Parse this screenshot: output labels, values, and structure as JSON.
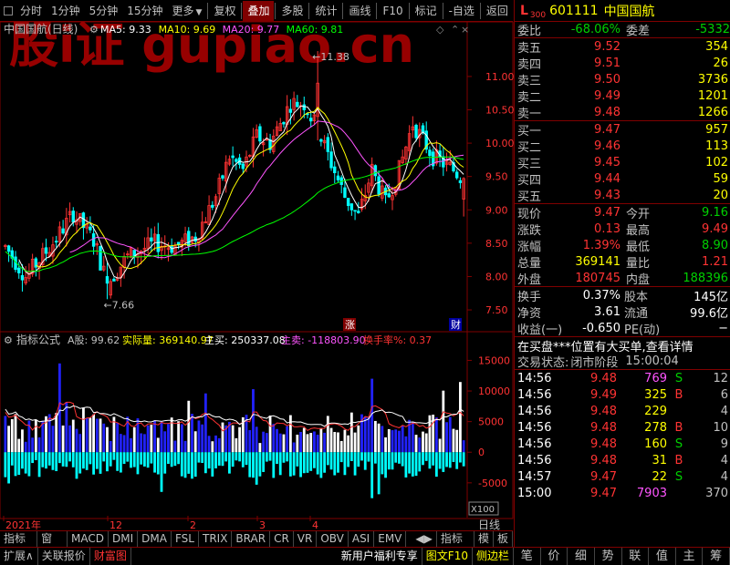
{
  "toolbar": {
    "periods": [
      "分时",
      "1分钟",
      "5分钟",
      "15分钟",
      "更多"
    ],
    "tools": [
      "复权",
      "叠加",
      "多股",
      "统计",
      "画线",
      "F10",
      "标记",
      "-自选",
      "返回"
    ],
    "active_tool": "叠加"
  },
  "watermark": "股i证 gupiao.cn",
  "main": {
    "title": "中国国航(日线)",
    "ma": [
      {
        "label": "MA5: 9.33",
        "color": "#ffffff"
      },
      {
        "label": "MA10: 9.69",
        "color": "#ffff00"
      },
      {
        "label": "MA20: 9.77",
        "color": "#ff55ff"
      },
      {
        "label": "MA60: 9.81",
        "color": "#00ff00"
      }
    ],
    "price_axis": [
      "11.00",
      "10.50",
      "10.00",
      "9.50",
      "9.00",
      "8.50",
      "8.00",
      "7.50"
    ],
    "high_label": "11.38",
    "low_label": "7.66",
    "tag_zhang": "涨",
    "tag_cai": "财"
  },
  "indicator": {
    "title": "指标公式",
    "items": [
      {
        "label": "A股: 99.62",
        "color": "#c0c0c0"
      },
      {
        "label": "实际量: 369140.97",
        "color": "#ffff00"
      },
      {
        "label": "主买: 250337.08",
        "color": "#ffffff"
      },
      {
        "label": "主卖: -118803.90",
        "color": "#ff55ff"
      },
      {
        "label": "换手率%: 0.37",
        "color": "#ff3333"
      }
    ],
    "axis": [
      "15000",
      "10000",
      "5000",
      "0",
      "-5000"
    ],
    "scale_tag": "X100"
  },
  "date_axis": [
    "2021年",
    "12",
    "2",
    "3",
    "4"
  ],
  "period_tag": "日线",
  "bottom_tabs": [
    "指标A",
    "窗口",
    "MACD",
    "DMI",
    "DMA",
    "FSL",
    "TRIX",
    "BRAR",
    "CR",
    "VR",
    "OBV",
    "ASI",
    "EMV"
  ],
  "bottom_right_tabs": [
    "指标B",
    "模",
    "板"
  ],
  "bottom_bar": {
    "left": [
      "扩展∧",
      "关联报价",
      "财富图"
    ],
    "right": [
      "新用户福利专享",
      "图文F10",
      "侧边栏"
    ]
  },
  "stock": {
    "code": "601111",
    "name": "中国国航",
    "mark": "L",
    "sub": "300"
  },
  "order_ratio": {
    "label1": "委比",
    "value1": "-68.06%",
    "label2": "委差",
    "value2": "-5332"
  },
  "sells": [
    {
      "label": "卖五",
      "price": "9.52",
      "vol": "354"
    },
    {
      "label": "卖四",
      "price": "9.51",
      "vol": "26"
    },
    {
      "label": "卖三",
      "price": "9.50",
      "vol": "3736"
    },
    {
      "label": "卖二",
      "price": "9.49",
      "vol": "1201"
    },
    {
      "label": "卖一",
      "price": "9.48",
      "vol": "1266"
    }
  ],
  "buys": [
    {
      "label": "买一",
      "price": "9.47",
      "vol": "957"
    },
    {
      "label": "买二",
      "price": "9.46",
      "vol": "113"
    },
    {
      "label": "买三",
      "price": "9.45",
      "vol": "102"
    },
    {
      "label": "买四",
      "price": "9.44",
      "vol": "59"
    },
    {
      "label": "买五",
      "price": "9.43",
      "vol": "20"
    }
  ],
  "quote": [
    {
      "l1": "现价",
      "v1": "9.47",
      "c1": "red",
      "l2": "今开",
      "v2": "9.16",
      "c2": "grn"
    },
    {
      "l1": "涨跌",
      "v1": "0.13",
      "c1": "red",
      "l2": "最高",
      "v2": "9.49",
      "c2": "red"
    },
    {
      "l1": "涨幅",
      "v1": "1.39%",
      "c1": "red",
      "l2": "最低",
      "v2": "8.90",
      "c2": "grn"
    },
    {
      "l1": "总量",
      "v1": "369141",
      "c1": "yel",
      "l2": "量比",
      "v2": "1.21",
      "c2": "red"
    },
    {
      "l1": "外盘",
      "v1": "180745",
      "c1": "red",
      "l2": "内盘",
      "v2": "188396",
      "c2": "grn"
    }
  ],
  "finance": [
    {
      "l1": "换手",
      "v1": "0.37%",
      "l2": "股本",
      "v2": "145亿"
    },
    {
      "l1": "净资",
      "v1": "3.61",
      "l2": "流通",
      "v2": "99.6亿"
    },
    {
      "l1": "收益(一)",
      "v1": "-0.650",
      "l2": "PE(动)",
      "v2": "−"
    }
  ],
  "notice": "在买盘***位置有大买单,查看详情",
  "status": {
    "label": "交易状态:",
    "value": "闭市阶段",
    "time": "15:00:04"
  },
  "ticks": [
    {
      "time": "14:56",
      "price": "9.48",
      "vol": "769",
      "bs": "S",
      "n": "12",
      "vc": "mag"
    },
    {
      "time": "14:56",
      "price": "9.49",
      "vol": "325",
      "bs": "B",
      "n": "6",
      "vc": "yel"
    },
    {
      "time": "14:56",
      "price": "9.48",
      "vol": "229",
      "bs": "",
      "n": "4",
      "vc": "yel"
    },
    {
      "time": "14:56",
      "price": "9.48",
      "vol": "278",
      "bs": "B",
      "n": "10",
      "vc": "yel"
    },
    {
      "time": "14:56",
      "price": "9.48",
      "vol": "160",
      "bs": "S",
      "n": "9",
      "vc": "yel"
    },
    {
      "time": "14:56",
      "price": "9.48",
      "vol": "31",
      "bs": "B",
      "n": "4",
      "vc": "yel"
    },
    {
      "time": "14:57",
      "price": "9.47",
      "vol": "22",
      "bs": "S",
      "n": "4",
      "vc": "yel"
    },
    {
      "time": "15:00",
      "price": "9.47",
      "vol": "7903",
      "bs": "",
      "n": "370",
      "vc": "mag"
    }
  ],
  "right_tabs": [
    "笔",
    "价",
    "细",
    "势",
    "联",
    "值",
    "主",
    "筹"
  ],
  "colors": {
    "up": "#ff3333",
    "down": "#00ffff",
    "border": "#800000",
    "ma60": "#00ff00"
  }
}
